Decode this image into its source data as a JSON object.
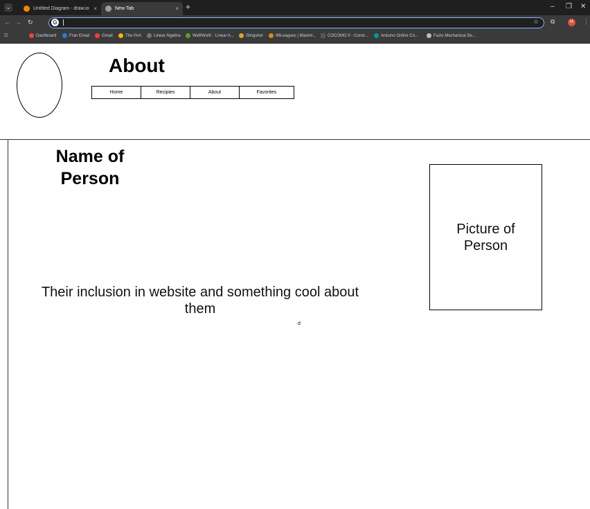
{
  "browser": {
    "tabs": [
      {
        "title": "Untitled Diagram - draw.io",
        "active": false
      },
      {
        "title": "New Tab",
        "active": true
      }
    ],
    "new_tab_symbol": "+",
    "address": "",
    "bookmarks": [
      "Dashboard",
      "Fran Email",
      "Gmail",
      "The Port",
      "Linear Algebra",
      "WeBWorK : Linear A...",
      "Slingshot",
      "IMLeagues | Maximi...",
      "COCOMO II - Const...",
      "Arduino Online Co...",
      "Fazio Mechanical Se..."
    ],
    "profile_initial": "M",
    "accent_color": "#8ab4f8"
  },
  "page": {
    "title": "About",
    "nav": [
      "Home",
      "Recipies",
      "About",
      "Favorites"
    ],
    "person_name": "Name of Person",
    "picture_label": "Picture of Person",
    "description": "Their inclusion in website and something cool about them",
    "stray_char": "d"
  }
}
